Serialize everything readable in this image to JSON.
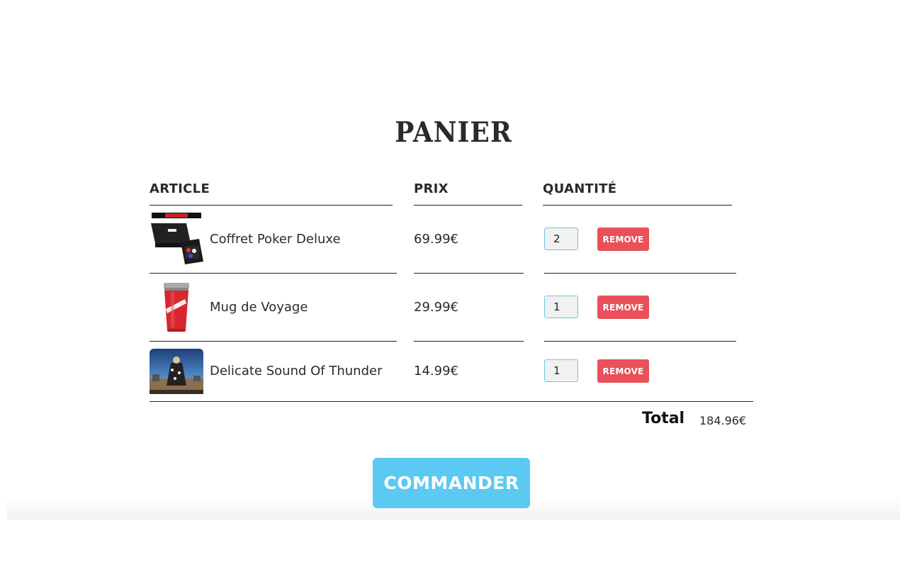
{
  "cart": {
    "title": "PANIER",
    "headers": {
      "article": "ARTICLE",
      "price": "PRIX",
      "quantity": "QUANTITÉ"
    },
    "items": [
      {
        "name": "Coffret Poker Deluxe",
        "price": "69.99€",
        "quantity": "2",
        "remove_label": "REMOVE"
      },
      {
        "name": "Mug de Voyage",
        "price": "29.99€",
        "quantity": "1",
        "remove_label": "REMOVE"
      },
      {
        "name": "Delicate Sound Of Thunder",
        "price": "14.99€",
        "quantity": "1",
        "remove_label": "REMOVE"
      }
    ],
    "total_label": "Total",
    "total_value": "184.96€",
    "order_label": "COMMANDER"
  },
  "colors": {
    "remove_button": "#ea505a",
    "order_button": "#5bc9f1",
    "quantity_border": "#6cc6e4"
  }
}
